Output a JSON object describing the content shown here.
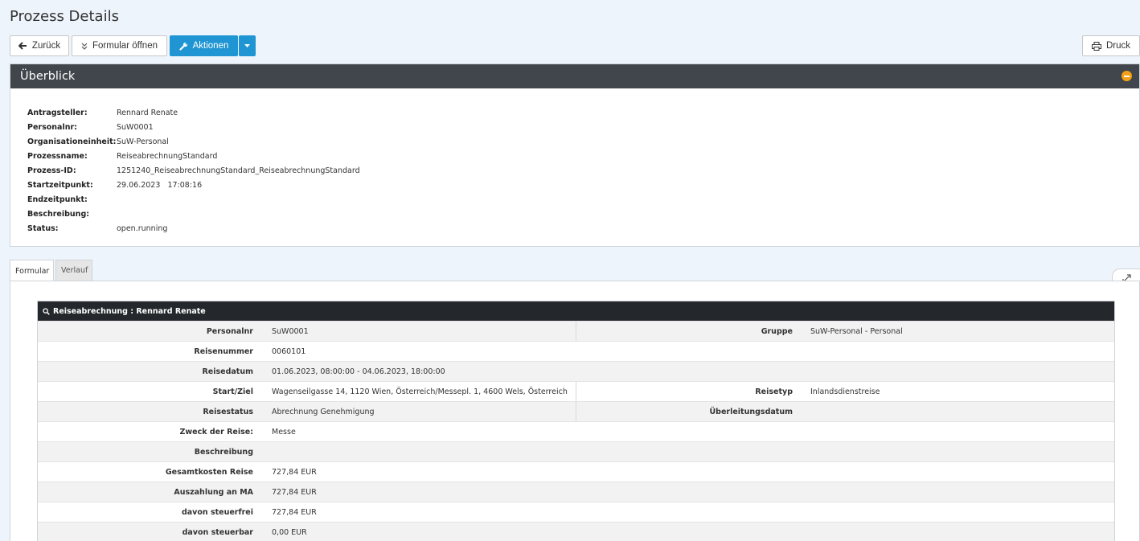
{
  "page": {
    "title": "Prozess Details"
  },
  "toolbar": {
    "back_label": "Zurück",
    "form_open_label": "Formular öffnen",
    "actions_label": "Aktionen",
    "print_label": "Druck"
  },
  "overview": {
    "title": "Überblick",
    "fields": [
      {
        "label": "Antragsteller:",
        "value": "Rennard Renate"
      },
      {
        "label": "Personalnr:",
        "value": "SuW0001"
      },
      {
        "label": "Organisationeinheit:",
        "value": "SuW-Personal"
      },
      {
        "label": "Prozessname:",
        "value": "ReiseabrechnungStandard"
      },
      {
        "label": "Prozess-ID:",
        "value": "1251240_ReiseabrechnungStandard_ReiseabrechnungStandard"
      },
      {
        "label": "Startzeitpunkt:",
        "value": "29.06.2023   17:08:16"
      },
      {
        "label": "Endzeitpunkt:",
        "value": ""
      },
      {
        "label": "Beschreibung:",
        "value": ""
      },
      {
        "label": "Status:",
        "value": "open.running"
      }
    ]
  },
  "tabs": [
    {
      "label": "Formular",
      "active": true
    },
    {
      "label": "Verlauf",
      "active": false
    }
  ],
  "record": {
    "title": "Reiseabrechnung : Rennard Renate",
    "rows": [
      {
        "label": "Personalnr",
        "value": "SuW0001",
        "label2": "Gruppe",
        "value2": "SuW-Personal - Personal"
      },
      {
        "label": "Reisenummer",
        "value": "0060101"
      },
      {
        "label": "Reisedatum",
        "value": "01.06.2023, 08:00:00 - 04.06.2023, 18:00:00"
      },
      {
        "label": "Start/Ziel",
        "value": "Wagenseilgasse 14, 1120 Wien, Österreich/Messepl. 1, 4600 Wels, Österreich",
        "label2": "Reisetyp",
        "value2": "Inlandsdienstreise"
      },
      {
        "label": "Reisestatus",
        "value": "Abrechnung Genehmigung",
        "label2": "Überleitungsdatum",
        "value2": ""
      },
      {
        "label": "Zweck der Reise:",
        "value": "Messe"
      },
      {
        "label": "Beschreibung",
        "value": ""
      },
      {
        "label": "Gesamtkosten Reise",
        "value": "727,84 EUR"
      },
      {
        "label": "Auszahlung an MA",
        "value": "727,84 EUR"
      },
      {
        "label": "davon steuerfrei",
        "value": "727,84 EUR"
      },
      {
        "label": "davon steuerbar",
        "value": "0,00 EUR"
      }
    ]
  },
  "colors": {
    "accent": "#1f95d3",
    "header_dark": "#40464c",
    "record_head": "#24282c",
    "collapse": "#f4a117"
  }
}
